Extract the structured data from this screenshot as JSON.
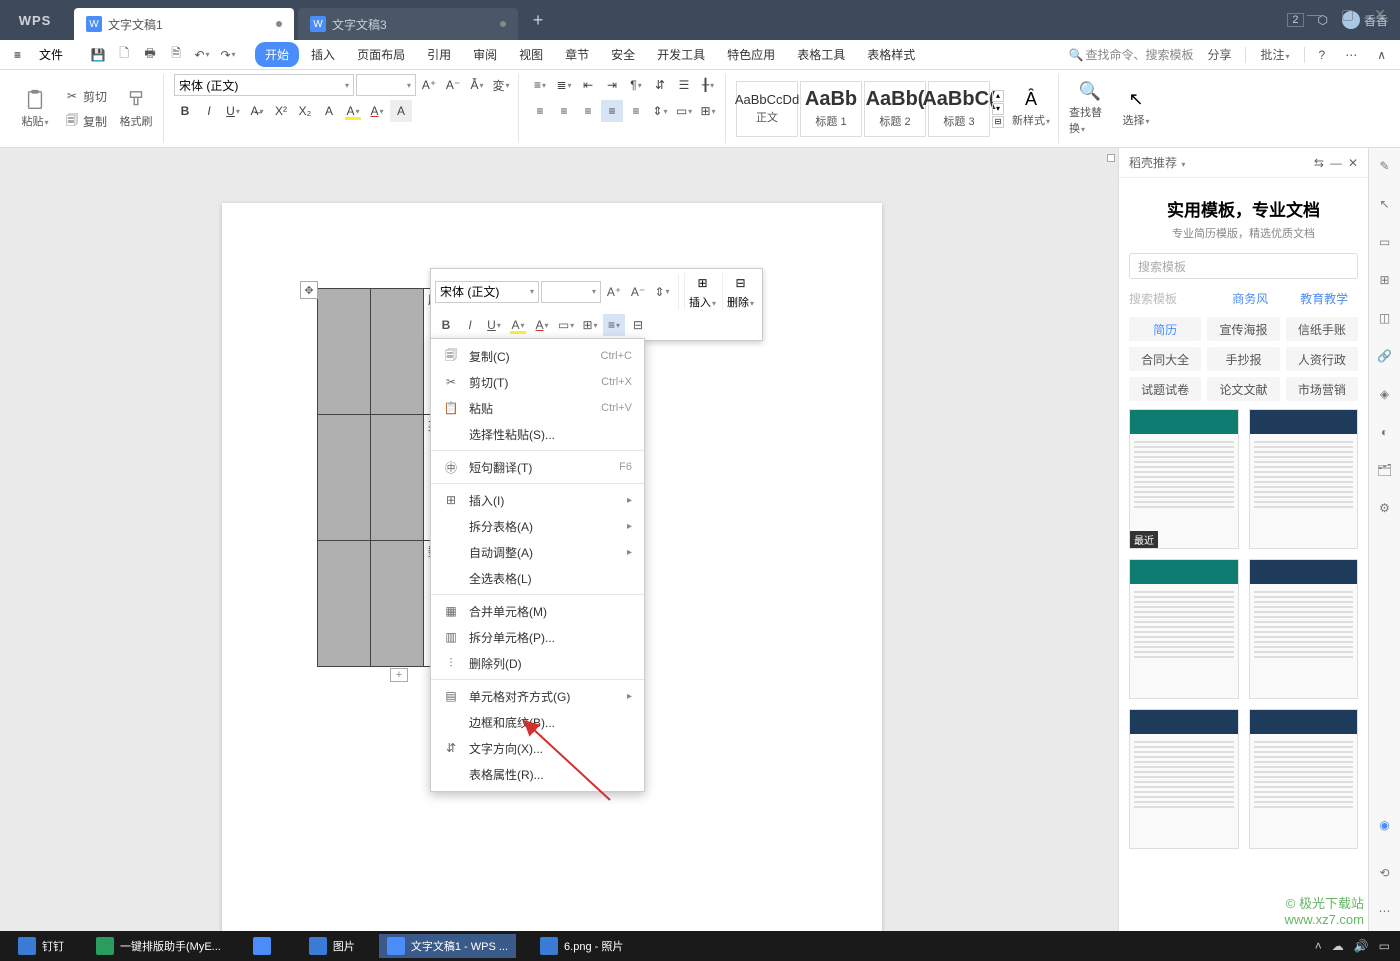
{
  "titlebar": {
    "logo": "WPS",
    "tabs": [
      {
        "label": "文字文稿1",
        "active": true,
        "dirty": true
      },
      {
        "label": "文字文稿3",
        "active": false,
        "dirty": true
      }
    ],
    "count_badge": "2",
    "user": "香香"
  },
  "menubar": {
    "file": "文件",
    "tabs": [
      "开始",
      "插入",
      "页面布局",
      "引用",
      "审阅",
      "视图",
      "章节",
      "安全",
      "开发工具",
      "特色应用",
      "表格工具",
      "表格样式"
    ],
    "active_index": 0,
    "search_placeholder": "查找命令、搜索模板",
    "share": "分享",
    "comment": "批注"
  },
  "ribbon": {
    "paste": "粘贴",
    "cut": "剪切",
    "copy": "复制",
    "format_painter": "格式刷",
    "font_name": "宋体 (正文)",
    "font_size": "",
    "styles": [
      {
        "preview": "AaBbCcDd",
        "label": "正文",
        "big": false
      },
      {
        "preview": "AaBb",
        "label": "标题 1",
        "big": true
      },
      {
        "preview": "AaBb(",
        "label": "标题 2",
        "big": true
      },
      {
        "preview": "AaBbC(",
        "label": "标题 3",
        "big": true
      }
    ],
    "new_style": "新样式",
    "find_replace": "查找替换",
    "select": "选择"
  },
  "doc": {
    "table_cells": [
      "历史",
      "英语",
      "数学"
    ]
  },
  "mini_toolbar": {
    "font_name": "宋体 (正文)",
    "insert": "插入",
    "delete": "删除"
  },
  "context_menu": [
    {
      "icon": "copy",
      "label": "复制(C)",
      "shortcut": "Ctrl+C"
    },
    {
      "icon": "cut",
      "label": "剪切(T)",
      "shortcut": "Ctrl+X"
    },
    {
      "icon": "paste",
      "label": "粘贴",
      "shortcut": "Ctrl+V"
    },
    {
      "icon": "",
      "label": "选择性粘贴(S)...",
      "shortcut": ""
    },
    {
      "sep": true
    },
    {
      "icon": "translate",
      "label": "短句翻译(T)",
      "shortcut": "F6"
    },
    {
      "sep": true
    },
    {
      "icon": "table",
      "label": "插入(I)",
      "submenu": true
    },
    {
      "icon": "",
      "label": "拆分表格(A)",
      "submenu": true
    },
    {
      "icon": "",
      "label": "自动调整(A)",
      "submenu": true
    },
    {
      "icon": "",
      "label": "全选表格(L)"
    },
    {
      "sep": true
    },
    {
      "icon": "merge",
      "label": "合并单元格(M)"
    },
    {
      "icon": "split",
      "label": "拆分单元格(P)..."
    },
    {
      "icon": "delcol",
      "label": "删除列(D)"
    },
    {
      "sep": true
    },
    {
      "icon": "align",
      "label": "单元格对齐方式(G)",
      "submenu": true
    },
    {
      "icon": "",
      "label": "边框和底纹(B)..."
    },
    {
      "icon": "textdir",
      "label": "文字方向(X)..."
    },
    {
      "icon": "",
      "label": "表格属性(R)..."
    }
  ],
  "side_panel": {
    "head": "稻壳推荐",
    "title": "实用模板，专业文档",
    "subtitle": "专业简历模版，精选优质文档",
    "search_placeholder": "搜索模板",
    "tabs": [
      "商务风",
      "教育教学"
    ],
    "cats": [
      "简历",
      "宣传海报",
      "信纸手账",
      "合同大全",
      "手抄报",
      "人资行政",
      "试题试卷",
      "论文文献",
      "市场营销"
    ],
    "active_cat": 0,
    "recent_label": "最近"
  },
  "taskbar": {
    "items": [
      {
        "label": "钉钉",
        "color": "#3a7bd5"
      },
      {
        "label": "一键排版助手(MyE...",
        "color": "#2a9d5e"
      },
      {
        "label": "",
        "color": "#4a8df8"
      },
      {
        "label": "图片",
        "color": "#3a7bd5"
      },
      {
        "label": "文字文稿1 - WPS ...",
        "color": "#4a8df8",
        "active": true
      },
      {
        "label": "6.png - 照片",
        "color": "#3a7bd5"
      }
    ]
  },
  "watermark": "© 极光下载站\nwww.xz7.com"
}
